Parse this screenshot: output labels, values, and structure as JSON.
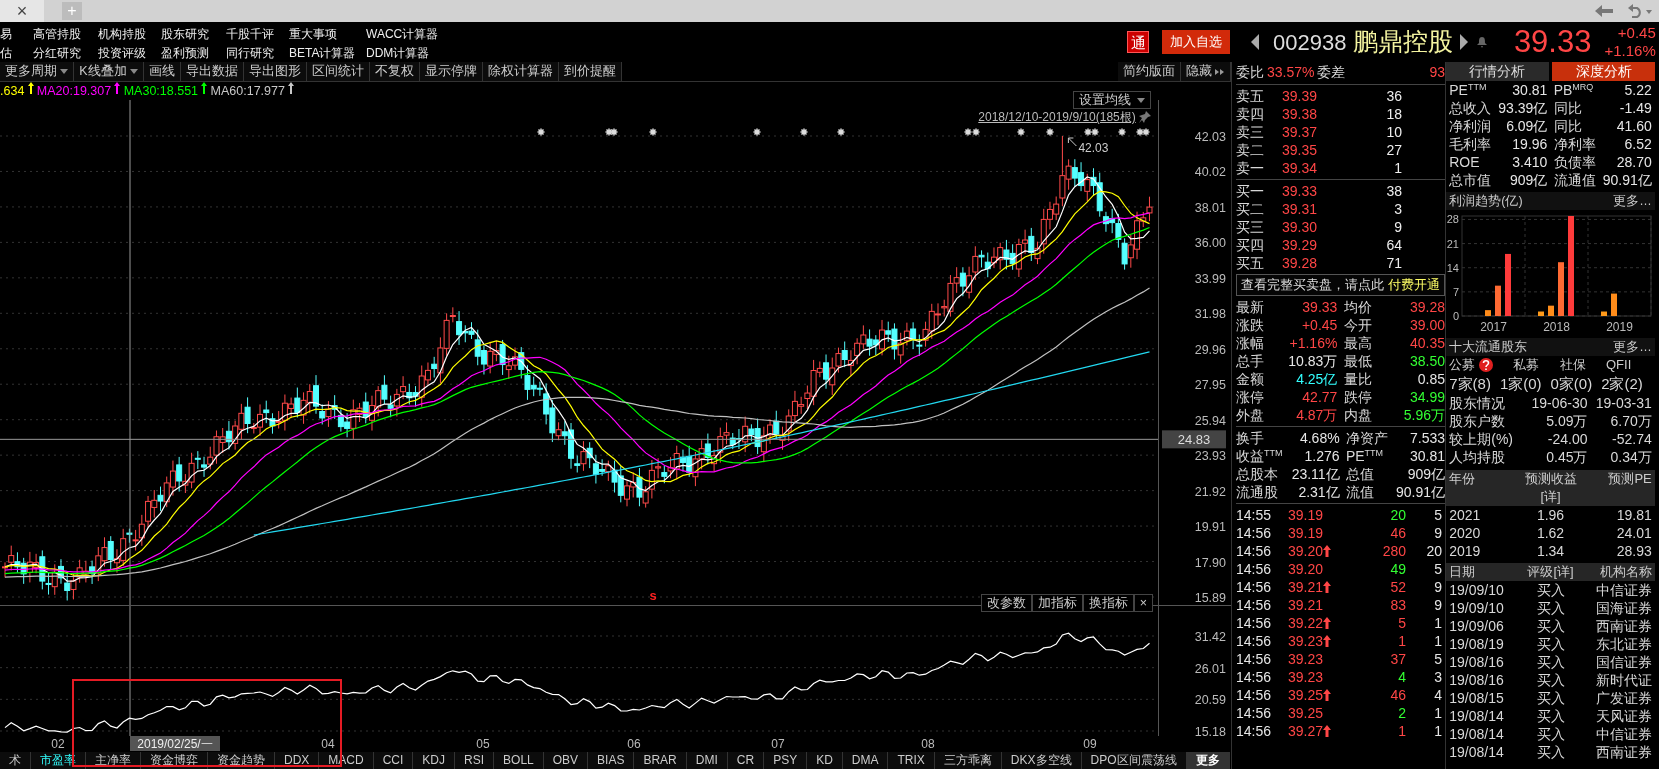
{
  "tab_strip": {
    "close_glyph": "×",
    "new_tab_glyph": "+"
  },
  "menu": {
    "rows": [
      [
        "易",
        "高管持股",
        "机构持股",
        "股东研究",
        "千股千评",
        "重大事项",
        "WACC计算器"
      ],
      [
        "估",
        "分红研究",
        "投资评级",
        "盈利预测",
        "同行研究",
        "BETA计算器",
        "DDM计算器"
      ]
    ]
  },
  "stock_header": {
    "badge": "通",
    "watch_button": "加入自选",
    "code": "002938",
    "name": "鹏鼎控股",
    "price": "39.33",
    "change": "+0.45",
    "change_pct": "+1.16%"
  },
  "toolbar": {
    "items": [
      {
        "label": "更多周期",
        "dropdown": true
      },
      {
        "label": "K线叠加",
        "dropdown": true
      },
      {
        "label": "画线",
        "dropdown": false
      },
      {
        "label": "导出数据",
        "dropdown": false
      },
      {
        "label": "导出图形",
        "dropdown": false
      },
      {
        "label": "区间统计",
        "dropdown": false
      },
      {
        "label": "不复权",
        "dropdown": false
      },
      {
        "label": "显示停牌",
        "dropdown": false
      },
      {
        "label": "除权计算器",
        "dropdown": false
      },
      {
        "label": "到价提醒",
        "dropdown": false
      }
    ],
    "right": [
      "简约版面",
      "隐藏"
    ]
  },
  "ma_legend": [
    {
      "label": ".634",
      "color": "#ffff00"
    },
    {
      "label": "MA20:19.307",
      "color": "#ff00ff"
    },
    {
      "label": "MA30:18.551",
      "color": "#00ff00"
    },
    {
      "label": "MA60:17.977",
      "color": "#c8c8c8"
    }
  ],
  "main_chart": {
    "ma_button": "设置均线",
    "range": "2018/12/10-2019/9/10(185根)",
    "high_marker": "42.03",
    "event_label": "s",
    "y_labels": [
      "42.03",
      "40.02",
      "38.01",
      "36.00",
      "33.99",
      "31.98",
      "29.96",
      "27.95",
      "25.94",
      "23.93",
      "21.92",
      "19.91",
      "17.90",
      "15.89"
    ],
    "cursor_value": "24.83"
  },
  "indicator_pane": {
    "buttons": [
      "改参数",
      "加指标",
      "换指标"
    ],
    "close_glyph": "×",
    "y_labels": [
      "31.42",
      "26.01",
      "20.59",
      "15.18"
    ]
  },
  "x_axis": {
    "labels": [
      "02",
      "04",
      "05",
      "06",
      "07",
      "08",
      "09"
    ],
    "cursor_label": "2019/02/25/一"
  },
  "indicator_tabs": [
    {
      "label": "术",
      "selected": false,
      "kind": "tab"
    },
    {
      "label": "市盈率",
      "selected": true,
      "kind": "tab"
    },
    {
      "label": "主净率",
      "selected": false,
      "kind": "tab"
    },
    {
      "label": "资金博弈",
      "selected": false,
      "kind": "tab"
    },
    {
      "label": "资金趋势",
      "selected": false,
      "kind": "tab"
    },
    {
      "label": "DDX",
      "selected": false,
      "kind": "tab"
    },
    {
      "label": "MACD",
      "selected": false,
      "kind": "tab"
    },
    {
      "label": "CCI",
      "selected": false,
      "kind": "tab"
    },
    {
      "label": "KDJ",
      "selected": false,
      "kind": "tab"
    },
    {
      "label": "RSI",
      "selected": false,
      "kind": "tab"
    },
    {
      "label": "BOLL",
      "selected": false,
      "kind": "tab"
    },
    {
      "label": "OBV",
      "selected": false,
      "kind": "tab"
    },
    {
      "label": "BIAS",
      "selected": false,
      "kind": "tab"
    },
    {
      "label": "BRAR",
      "selected": false,
      "kind": "tab"
    },
    {
      "label": "DMI",
      "selected": false,
      "kind": "tab"
    },
    {
      "label": "CR",
      "selected": false,
      "kind": "tab"
    },
    {
      "label": "PSY",
      "selected": false,
      "kind": "tab"
    },
    {
      "label": "KD",
      "selected": false,
      "kind": "tab"
    },
    {
      "label": "DMA",
      "selected": false,
      "kind": "tab"
    },
    {
      "label": "TRIX",
      "selected": false,
      "kind": "tab"
    },
    {
      "label": "三方乖离",
      "selected": false,
      "kind": "tab"
    },
    {
      "label": "DKX多空线",
      "selected": false,
      "kind": "tab"
    },
    {
      "label": "DPO区间震荡线",
      "selected": false,
      "kind": "tab"
    },
    {
      "label": "更多",
      "selected": false,
      "kind": "more"
    }
  ],
  "order_book": {
    "ratio": {
      "label": "委比",
      "value": "33.57%",
      "label2": "委差",
      "value2": "93"
    },
    "asks": [
      {
        "label": "卖五",
        "price": "39.39",
        "volume": "36"
      },
      {
        "label": "卖四",
        "price": "39.38",
        "volume": "18"
      },
      {
        "label": "卖三",
        "price": "39.37",
        "volume": "10"
      },
      {
        "label": "卖二",
        "price": "39.35",
        "volume": "27"
      },
      {
        "label": "卖一",
        "price": "39.34",
        "volume": "1"
      }
    ],
    "bids": [
      {
        "label": "买一",
        "price": "39.33",
        "volume": "38"
      },
      {
        "label": "买二",
        "price": "39.31",
        "volume": "3"
      },
      {
        "label": "买三",
        "price": "39.30",
        "volume": "9"
      },
      {
        "label": "买四",
        "price": "39.29",
        "volume": "64"
      },
      {
        "label": "买五",
        "price": "39.28",
        "volume": "71"
      }
    ],
    "notice": {
      "text": "查看完整买卖盘，请点此",
      "link": "付费开通"
    }
  },
  "quote_stats": [
    {
      "label": "最新",
      "value": "39.33",
      "color": "#ff4646"
    },
    {
      "label": "均价",
      "value": "39.28",
      "color": "#ff4646"
    },
    {
      "label": "涨跌",
      "value": "+0.45",
      "color": "#ff4646"
    },
    {
      "label": "今开",
      "value": "39.00",
      "color": "#ff4646"
    },
    {
      "label": "涨幅",
      "value": "+1.16%",
      "color": "#ff4646"
    },
    {
      "label": "最高",
      "value": "40.35",
      "color": "#ff4646"
    },
    {
      "label": "总手",
      "value": "10.83万",
      "color": "#e6e6e6"
    },
    {
      "label": "最低",
      "value": "38.50",
      "color": "#33ff33"
    },
    {
      "label": "金额",
      "value": "4.25亿",
      "color": "#33ffff"
    },
    {
      "label": "量比",
      "value": "0.85",
      "color": "#e6e6e6"
    },
    {
      "label": "涨停",
      "value": "42.77",
      "color": "#ff4646"
    },
    {
      "label": "跌停",
      "value": "34.99",
      "color": "#33ff33"
    },
    {
      "label": "外盘",
      "value": "4.87万",
      "color": "#ff4646"
    },
    {
      "label": "内盘",
      "value": "5.96万",
      "color": "#33ff33"
    }
  ],
  "fundamentals": [
    {
      "label": "换手",
      "value": "4.68%",
      "label2": "净资产",
      "value2": "7.533"
    },
    {
      "label": "收益$^{TTM}$",
      "value": "1.276",
      "label2": "PE$^{TTM}$",
      "value2": "30.81"
    },
    {
      "label": "总股本",
      "value": "23.11亿",
      "label2": "总值",
      "value2": "909亿"
    },
    {
      "label": "流通股",
      "value": "2.31亿",
      "label2": "流值",
      "value2": "90.91亿"
    }
  ],
  "trades": [
    {
      "time": "14:55",
      "price": "39.19",
      "uptick": false,
      "volume": "20",
      "color": "#33ff33",
      "count": "5"
    },
    {
      "time": "14:56",
      "price": "39.19",
      "uptick": false,
      "volume": "46",
      "color": "#ff4646",
      "count": "9"
    },
    {
      "time": "14:56",
      "price": "39.20",
      "uptick": true,
      "volume": "280",
      "color": "#ff4646",
      "count": "20"
    },
    {
      "time": "14:56",
      "price": "39.20",
      "uptick": false,
      "volume": "49",
      "color": "#33ff33",
      "count": "5"
    },
    {
      "time": "14:56",
      "price": "39.21",
      "uptick": true,
      "volume": "52",
      "color": "#ff4646",
      "count": "9"
    },
    {
      "time": "14:56",
      "price": "39.21",
      "uptick": false,
      "volume": "83",
      "color": "#ff4646",
      "count": "9"
    },
    {
      "time": "14:56",
      "price": "39.22",
      "uptick": true,
      "volume": "5",
      "color": "#ff4646",
      "count": "1"
    },
    {
      "time": "14:56",
      "price": "39.23",
      "uptick": true,
      "volume": "1",
      "color": "#ff4646",
      "count": "1"
    },
    {
      "time": "14:56",
      "price": "39.23",
      "uptick": false,
      "volume": "37",
      "color": "#ff4646",
      "count": "5"
    },
    {
      "time": "14:56",
      "price": "39.23",
      "uptick": false,
      "volume": "4",
      "color": "#33ff33",
      "count": "3"
    },
    {
      "time": "14:56",
      "price": "39.25",
      "uptick": true,
      "volume": "46",
      "color": "#ff4646",
      "count": "4"
    },
    {
      "time": "14:56",
      "price": "39.25",
      "uptick": false,
      "volume": "2",
      "color": "#33ff33",
      "count": "1"
    },
    {
      "time": "14:56",
      "price": "39.27",
      "uptick": true,
      "volume": "1",
      "color": "#ff4646",
      "count": "1"
    }
  ],
  "analysis_tabs": [
    {
      "label": "行情分析",
      "selected": false
    },
    {
      "label": "深度分析",
      "selected": true
    }
  ],
  "valuation": [
    {
      "label": "PE$^{TTM}$",
      "value": "30.81",
      "label2": "PB$^{MRQ}$",
      "value2": "5.22"
    },
    {
      "label": "总收入",
      "value": "93.39亿",
      "label2": "同比",
      "value2": "-1.49"
    },
    {
      "label": "净利润",
      "value": "6.09亿",
      "label2": "同比",
      "value2": "41.60"
    },
    {
      "label": "毛利率",
      "value": "19.96",
      "label2": "净利率",
      "value2": "6.52"
    },
    {
      "label": "ROE",
      "value": "3.410",
      "label2": "负债率",
      "value2": "28.70"
    },
    {
      "label": "总市值",
      "value": "909亿",
      "label2": "流通值",
      "value2": "90.91亿"
    }
  ],
  "profit_trend": {
    "title": "利润趋势(亿)",
    "more": "更多…",
    "chart_data": {
      "type": "bar",
      "grid": true,
      "categories": [
        "2017",
        "2018",
        "2019"
      ],
      "ylim": [
        0,
        29
      ],
      "yticks": [
        0,
        7,
        14,
        21,
        28
      ],
      "series": [
        {
          "color": "#ff9a1a",
          "values": [
            null,
            1.3,
            1.3
          ]
        },
        {
          "color": "#ff8c1a",
          "values": [
            1.7,
            3.0,
            6.5
          ]
        },
        {
          "color": "#ff6a33",
          "values": [
            8.8,
            15.6,
            null
          ]
        },
        {
          "color": "#ff3b3b",
          "values": [
            18.0,
            29.0,
            null
          ]
        }
      ]
    }
  },
  "shareholders": {
    "title": "十大流通股东",
    "more": "更多…",
    "categories": [
      {
        "label": "公募",
        "help": true
      },
      {
        "label": "私募",
        "help": false
      },
      {
        "label": "社保",
        "help": false
      },
      {
        "label": "QFII",
        "help": false
      }
    ],
    "counts": [
      "7家(8)",
      "1家(0)",
      "0家(0)",
      "2家(2)"
    ],
    "rows": [
      {
        "label": "股东情况",
        "values": [
          "19-06-30",
          "19-03-31"
        ]
      },
      {
        "label": "股东户数",
        "values": [
          "5.09万",
          "6.70万"
        ]
      },
      {
        "label": "较上期(%)",
        "values": [
          "-24.00",
          "-52.74"
        ]
      },
      {
        "label": "人均持股",
        "values": [
          "0.45万",
          "0.34万"
        ]
      }
    ]
  },
  "forecast": {
    "columns": [
      "年份",
      "预测收益",
      "预测PE"
    ],
    "detail": "[详]",
    "rows": [
      [
        "2021",
        "1.96",
        "19.81"
      ],
      [
        "2020",
        "1.62",
        "24.01"
      ],
      [
        "2019",
        "1.34",
        "28.93"
      ]
    ]
  },
  "ratings": {
    "columns": [
      "日期",
      "评级",
      "机构名称"
    ],
    "detail": "[详]",
    "rows": [
      [
        "19/09/10",
        "买入",
        "中信证券"
      ],
      [
        "19/09/10",
        "买入",
        "国海证券"
      ],
      [
        "19/09/06",
        "买入",
        "西南证券"
      ],
      [
        "19/08/19",
        "买入",
        "东北证券"
      ],
      [
        "19/08/16",
        "买入",
        "国信证券"
      ],
      [
        "19/08/16",
        "买入",
        "新时代证"
      ],
      [
        "19/08/15",
        "买入",
        "广发证券"
      ],
      [
        "19/08/14",
        "买入",
        "天风证券"
      ],
      [
        "19/08/14",
        "买入",
        "中信证券"
      ],
      [
        "19/08/14",
        "买入",
        "西南证券"
      ]
    ]
  }
}
